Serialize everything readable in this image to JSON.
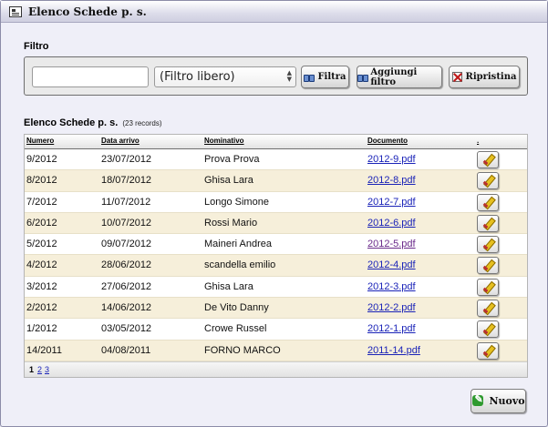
{
  "window": {
    "title": "Elenco Schede p. s."
  },
  "filter": {
    "section_label": "Filtro",
    "input_value": "",
    "select_value": "(Filtro libero)",
    "buttons": {
      "filtra": "Filtra",
      "aggiungi": "Aggiungi filtro",
      "ripristina": "Ripristina"
    }
  },
  "list": {
    "title": "Elenco Schede p. s.",
    "count": "(23 records)",
    "headers": {
      "numero": "Numero",
      "data": "Data arrivo",
      "nominativo": "Nominativo",
      "documento": "Documento",
      "action": "."
    },
    "rows": [
      {
        "numero": "9/2012",
        "data": "23/07/2012",
        "nominativo": "Prova Prova",
        "documento": "2012-9.pdf"
      },
      {
        "numero": "8/2012",
        "data": "18/07/2012",
        "nominativo": "Ghisa Lara",
        "documento": "2012-8.pdf"
      },
      {
        "numero": "7/2012",
        "data": "11/07/2012",
        "nominativo": "Longo Simone",
        "documento": "2012-7.pdf"
      },
      {
        "numero": "6/2012",
        "data": "10/07/2012",
        "nominativo": "Rossi Mario",
        "documento": "2012-6.pdf"
      },
      {
        "numero": "5/2012",
        "data": "09/07/2012",
        "nominativo": "Maineri Andrea",
        "documento": "2012-5.pdf"
      },
      {
        "numero": "4/2012",
        "data": "28/06/2012",
        "nominativo": "scandella emilio",
        "documento": "2012-4.pdf"
      },
      {
        "numero": "3/2012",
        "data": "27/06/2012",
        "nominativo": "Ghisa Lara",
        "documento": "2012-3.pdf"
      },
      {
        "numero": "2/2012",
        "data": "14/06/2012",
        "nominativo": "De Vito Danny",
        "documento": "2012-2.pdf"
      },
      {
        "numero": "1/2012",
        "data": "03/05/2012",
        "nominativo": "Crowe Russel",
        "documento": "2012-1.pdf"
      },
      {
        "numero": "14/2011",
        "data": "04/08/2011",
        "nominativo": "FORNO MARCO",
        "documento": "2011-14.pdf"
      }
    ],
    "pager": {
      "current": "1",
      "page2": "2",
      "page3": "3"
    }
  },
  "footer": {
    "nuovo": "Nuovo"
  },
  "colors": {
    "link": "#1a23b8",
    "visited_link": "#6a2a8a",
    "row_alt": "#f6efda"
  }
}
